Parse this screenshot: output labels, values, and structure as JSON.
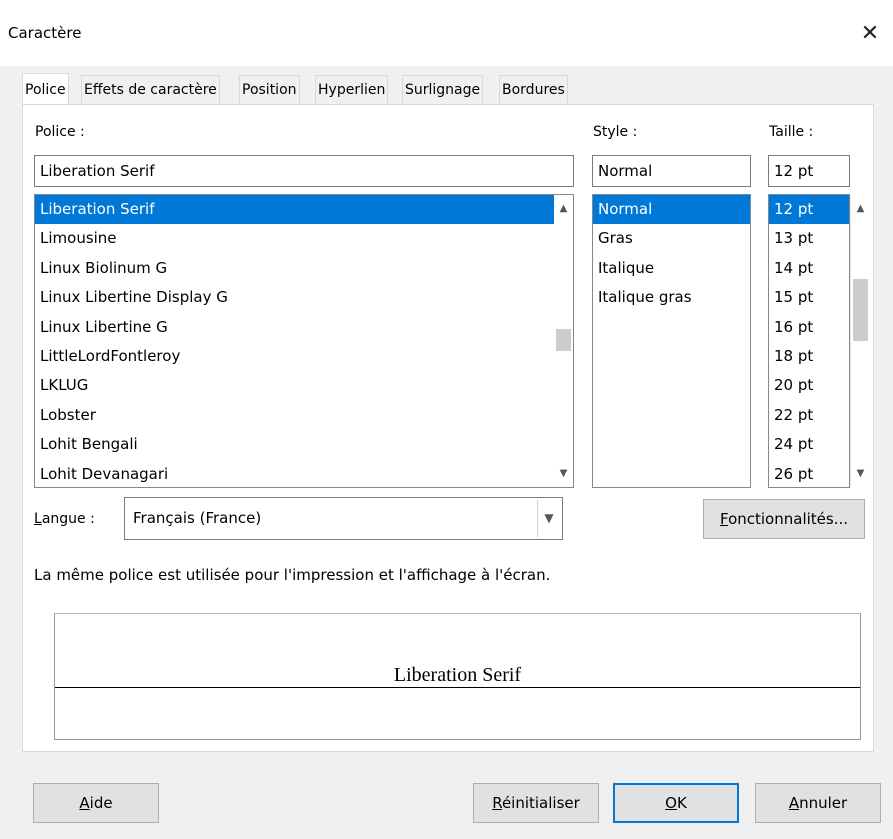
{
  "window": {
    "title": "Caractère",
    "close_glyph": "✕"
  },
  "tabs": [
    "Police",
    "Effets de caractère",
    "Position",
    "Hyperlien",
    "Surlignage",
    "Bordures"
  ],
  "font": {
    "label": "Police :",
    "value": "Liberation Serif",
    "items": [
      "Liberation Serif",
      "Limousine",
      "Linux Biolinum G",
      "Linux Libertine Display G",
      "Linux Libertine G",
      "LittleLordFontleroy",
      "LKLUG",
      "Lobster",
      "Lohit Bengali",
      "Lohit Devanagari"
    ],
    "selected_index": 0
  },
  "style": {
    "label": "Style :",
    "value": "Normal",
    "items": [
      "Normal",
      "Gras",
      "Italique",
      "Italique gras"
    ],
    "selected_index": 0
  },
  "size": {
    "label": "Taille :",
    "value": "12 pt",
    "items": [
      "12 pt",
      "13 pt",
      "14 pt",
      "15 pt",
      "16 pt",
      "18 pt",
      "20 pt",
      "22 pt",
      "24 pt",
      "26 pt"
    ],
    "selected_index": 0
  },
  "language": {
    "label_first": "L",
    "label_rest": "angue :",
    "value": "Français (France)"
  },
  "features_button": {
    "first": "F",
    "rest": "onctionnalités..."
  },
  "info_text": "La même police est utilisée pour l'impression et l'affichage à l'écran.",
  "preview_text": "Liberation Serif",
  "buttons": {
    "help": {
      "first": "A",
      "rest": "ide"
    },
    "reset": {
      "first": "R",
      "rest": "éinitialiser"
    },
    "ok": {
      "first": "O",
      "rest": "K"
    },
    "cancel": {
      "first": "A",
      "rest": "nnuler"
    }
  },
  "colors": {
    "selection": "#0078d7",
    "dialog_bg": "#f0f0f0"
  },
  "icons": {
    "scroll_up": "chevron-up-icon",
    "scroll_down": "chevron-down-icon",
    "close": "close-icon",
    "dropdown": "chevron-down-icon"
  }
}
